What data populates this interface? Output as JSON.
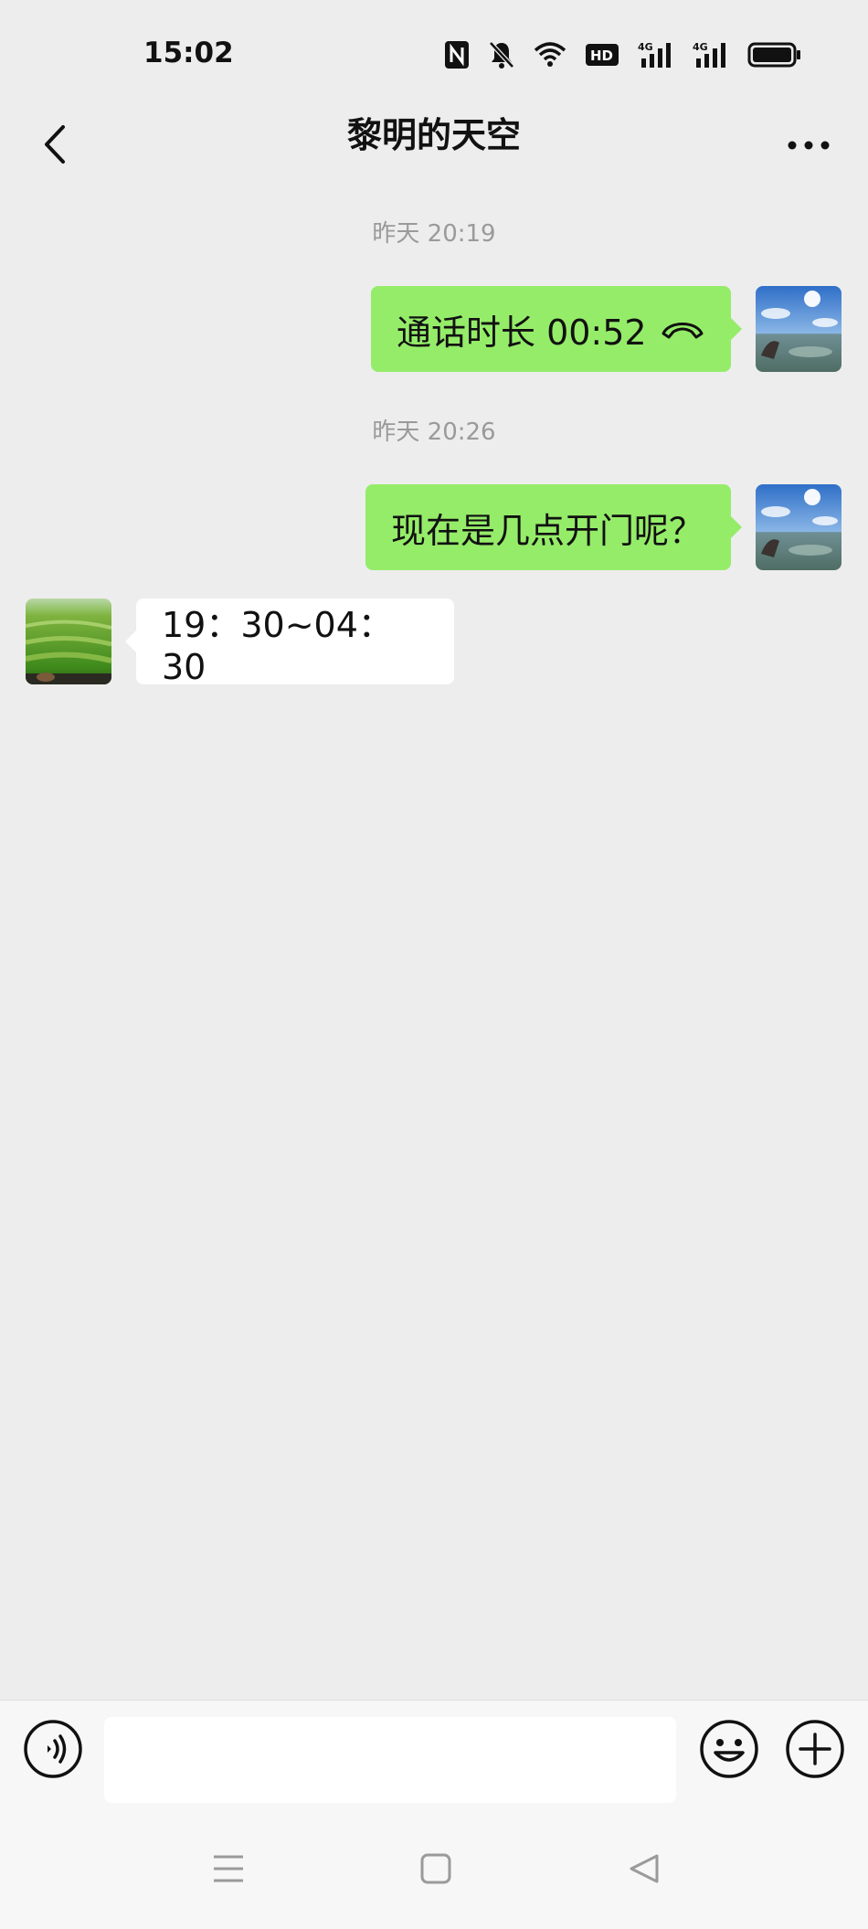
{
  "status": {
    "time": "15:02",
    "icons": [
      "nfc-icon",
      "mute-bell-icon",
      "wifi-icon",
      "hd-icon",
      "4g-signal-icon",
      "4g-signal-icon",
      "battery-icon"
    ],
    "hd_label": "HD",
    "net_label": "4G"
  },
  "header": {
    "title": "黎明的天空",
    "back_icon": "chevron-left-icon",
    "more_icon": "more-dots-icon"
  },
  "messages": [
    {
      "type": "timestamp",
      "text": "昨天 20:19"
    },
    {
      "type": "call",
      "side": "mine",
      "text": "通话时长 00:52",
      "icon": "phone-hangup-icon"
    },
    {
      "type": "timestamp",
      "text": "昨天 20:26"
    },
    {
      "type": "text",
      "side": "mine",
      "text": "现在是几点开门呢？"
    },
    {
      "type": "text",
      "side": "theirs",
      "text": "19：30~04：30"
    }
  ],
  "input_bar": {
    "voice_icon": "voice-icon",
    "input_value": "",
    "emoji_icon": "emoji-icon",
    "plus_icon": "plus-icon"
  },
  "system_nav": [
    "menu-icon",
    "home-icon",
    "back-triangle-icon"
  ],
  "colors": {
    "background": "#ededed",
    "my_bubble": "#95ec69",
    "their_bubble": "#ffffff"
  }
}
